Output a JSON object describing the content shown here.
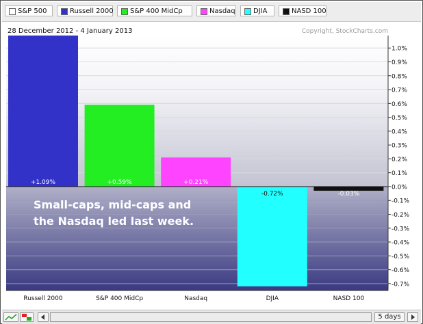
{
  "legend": [
    {
      "label": "S&P 500",
      "color": "#ffffff"
    },
    {
      "label": "Russell 2000",
      "color": "#3232c8"
    },
    {
      "label": "S&P 400 MidCp",
      "color": "#22ee22"
    },
    {
      "label": "Nasdaq",
      "color": "#ff44ff"
    },
    {
      "label": "DJIA",
      "color": "#22ffff"
    },
    {
      "label": "NASD 100",
      "color": "#111111"
    }
  ],
  "chart_data": {
    "type": "bar",
    "categories": [
      "Russell 2000",
      "S&P 400 MidCp",
      "Nasdaq",
      "DJIA",
      "NASD 100"
    ],
    "values": [
      1.09,
      0.59,
      0.21,
      -0.72,
      -0.03
    ],
    "value_labels": [
      "+1.09%",
      "+0.59%",
      "+0.21%",
      "-0.72%",
      "-0.03%"
    ],
    "colors": [
      "#3232c8",
      "#22ee22",
      "#ff44ff",
      "#22ffff",
      "#111111"
    ],
    "date_range": "28 December 2012 - 4 January 2013",
    "copyright": "Copyright, StockCharts.com",
    "annotation": [
      "Small-caps, mid-caps and",
      "the Nasdaq led last week."
    ],
    "ylim": [
      -0.75,
      1.09
    ],
    "yticks": [
      1.0,
      0.9,
      0.8,
      0.7,
      0.6,
      0.5,
      0.4,
      0.3,
      0.2,
      0.1,
      0.0,
      -0.1,
      -0.2,
      -0.3,
      -0.4,
      -0.5,
      -0.6,
      -0.7
    ],
    "ytick_labels": [
      "1.0%",
      "0.9%",
      "0.8%",
      "0.7%",
      "0.6%",
      "0.5%",
      "0.4%",
      "0.3%",
      "0.2%",
      "0.1%",
      "0.0%",
      "-0.1%",
      "-0.2%",
      "-0.3%",
      "-0.4%",
      "-0.5%",
      "-0.6%",
      "-0.7%"
    ],
    "grid": true
  },
  "toolbar": {
    "period_label": "5 days"
  }
}
